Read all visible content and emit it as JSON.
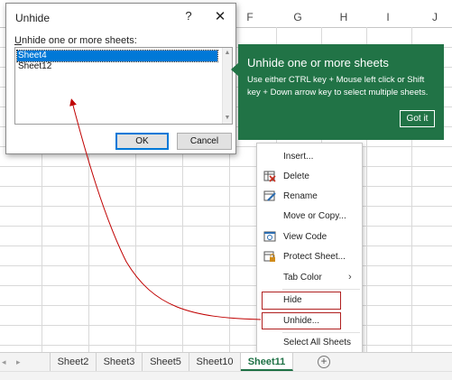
{
  "grid": {
    "columns": [
      "F",
      "G",
      "H",
      "I",
      "J"
    ]
  },
  "dialog": {
    "title": "Unhide",
    "help": "?",
    "close": "✕",
    "label_prefix": "",
    "label_underlined": "U",
    "label_rest": "nhide one or more sheets:",
    "sheets": [
      "Sheet4",
      "Sheet12"
    ],
    "selected_sheet": "Sheet4",
    "ok_label": "OK",
    "cancel_label": "Cancel"
  },
  "tip": {
    "title": "Unhide one or more sheets",
    "body": "Use either CTRL key + Mouse left click or Shift key + Down arrow key to select multiple sheets.",
    "button": "Got it",
    "background": "#217346"
  },
  "context_menu": {
    "items": [
      {
        "label": "Insert...",
        "icon": ""
      },
      {
        "label": "Delete",
        "icon": "delete-sheet-icon"
      },
      {
        "label": "Rename",
        "icon": "rename-sheet-icon"
      },
      {
        "label": "Move or Copy...",
        "icon": ""
      },
      {
        "label": "View Code",
        "icon": "view-code-icon"
      },
      {
        "label": "Protect Sheet...",
        "icon": "protect-sheet-icon"
      },
      {
        "label": "Tab Color",
        "icon": "",
        "submenu": "›"
      },
      {
        "label": "Hide",
        "icon": ""
      },
      {
        "label": "Unhide...",
        "icon": ""
      },
      {
        "label": "Select All Sheets",
        "icon": ""
      }
    ],
    "highlight_color": "#b02020"
  },
  "tabs": {
    "nav_prev": "◂",
    "nav_next": "▸",
    "items": [
      "Sheet2",
      "Sheet3",
      "Sheet5",
      "Sheet10",
      "Sheet11"
    ],
    "active": "Sheet11",
    "add": "+",
    "accent": "#1e7145"
  }
}
